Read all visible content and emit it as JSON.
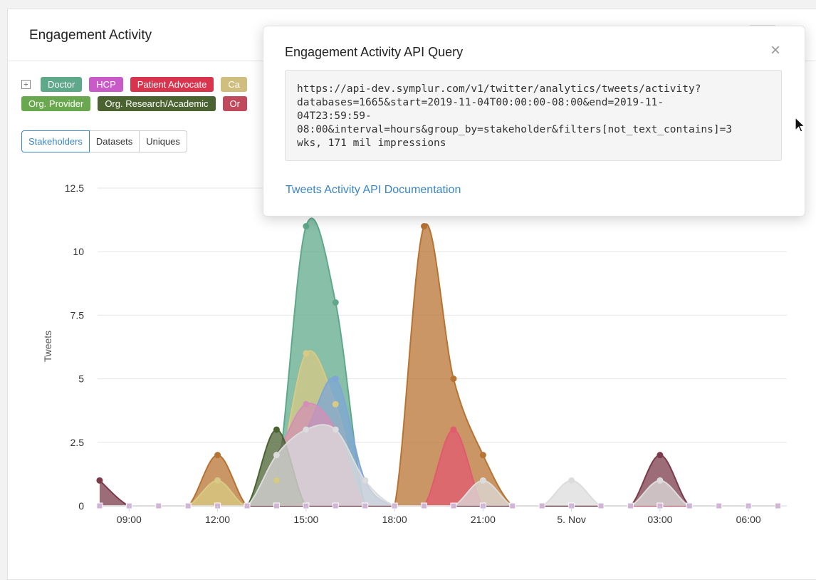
{
  "card": {
    "title": "Engagement Activity"
  },
  "legend": {
    "expand_label": "+",
    "row1": [
      {
        "label": "Doctor",
        "color": "#5fa98b"
      },
      {
        "label": "HCP",
        "color": "#c85bc7"
      },
      {
        "label": "Patient Advocate",
        "color": "#d8344d"
      },
      {
        "label": "Ca",
        "color": "#cfbe7d"
      }
    ],
    "row2": [
      {
        "label": "Org. Provider",
        "color": "#6aa84f"
      },
      {
        "label": "Org. Research/Academic",
        "color": "#4a6331"
      },
      {
        "label": "Or",
        "color": "#c0495c"
      }
    ]
  },
  "tabs": [
    {
      "label": "Stakeholders",
      "active": true
    },
    {
      "label": "Datasets",
      "active": false
    },
    {
      "label": "Uniques",
      "active": false
    }
  ],
  "popover": {
    "title": "Engagement Activity API Query",
    "close": "×",
    "query": "https://api-dev.symplur.com/v1/twitter/analytics/tweets/activity?\ndatabases=1665&start=2019-11-04T00:00:00-08:00&end=2019-11-\n04T23:59:59-\n08:00&interval=hours&group_by=stakeholder&filters[not_text_contains]=3\nwks, 171 mil impressions",
    "doc_link": "Tweets Activity API Documentation"
  },
  "chart_data": {
    "type": "area",
    "ylabel": "Tweets",
    "ylim": [
      0,
      12.5
    ],
    "yticks": [
      "0",
      "2.5",
      "5",
      "7.5",
      "10",
      "12.5"
    ],
    "x_hours": [
      8,
      9,
      10,
      11,
      12,
      13,
      14,
      15,
      16,
      17,
      18,
      19,
      20,
      21,
      22,
      23,
      24,
      25,
      26,
      27,
      28,
      29,
      30,
      31
    ],
    "xticks": [
      {
        "h": 9,
        "label": "09:00"
      },
      {
        "h": 12,
        "label": "12:00"
      },
      {
        "h": 15,
        "label": "15:00"
      },
      {
        "h": 18,
        "label": "18:00"
      },
      {
        "h": 21,
        "label": "21:00"
      },
      {
        "h": 24,
        "label": "5. Nov"
      },
      {
        "h": 27,
        "label": "03:00"
      },
      {
        "h": 30,
        "label": "06:00"
      }
    ],
    "series": [
      {
        "color": "#b87333",
        "values": [
          0,
          0,
          0,
          0,
          2,
          0,
          0,
          0,
          0,
          0,
          0,
          11,
          5,
          2,
          0,
          0,
          0,
          0,
          0,
          0,
          0,
          0,
          0,
          0
        ]
      },
      {
        "color": "#5fa98b",
        "values": [
          0,
          0,
          0,
          0,
          0,
          0,
          1,
          11,
          8,
          0,
          0,
          0,
          0,
          0,
          0,
          0,
          0,
          0,
          0,
          0,
          0,
          0,
          0,
          0
        ]
      },
      {
        "color": "#d8ca84",
        "values": [
          0,
          0,
          0,
          0,
          1,
          0,
          1,
          6,
          4,
          0,
          0,
          0,
          0,
          0,
          0,
          0,
          0,
          0,
          0,
          0,
          0,
          0,
          0,
          0
        ]
      },
      {
        "color": "#7fa6d6",
        "values": [
          0,
          0,
          0,
          0,
          0,
          0,
          2,
          3,
          5,
          1,
          0,
          0,
          0,
          0,
          0,
          0,
          0,
          0,
          0,
          0,
          0,
          0,
          0,
          0
        ]
      },
      {
        "color": "#d48fb6",
        "values": [
          0,
          0,
          0,
          0,
          0,
          0,
          2,
          4,
          3,
          0,
          0,
          0,
          0,
          0,
          0,
          0,
          0,
          0,
          0,
          0,
          0,
          0,
          0,
          0
        ]
      },
      {
        "color": "#4a6331",
        "values": [
          0,
          0,
          0,
          0,
          0,
          0,
          3,
          0,
          0,
          0,
          0,
          0,
          0,
          0,
          0,
          0,
          0,
          0,
          0,
          0,
          0,
          0,
          0,
          0
        ]
      },
      {
        "color": "#e05a70",
        "values": [
          0,
          0,
          0,
          0,
          0,
          0,
          0,
          0,
          0,
          0,
          0,
          0,
          3,
          0,
          0,
          0,
          0,
          0,
          0,
          0,
          0,
          0,
          0,
          0
        ]
      },
      {
        "color": "#7b3b4b",
        "values": [
          1,
          0,
          0,
          0,
          0,
          0,
          0,
          0,
          0,
          0,
          0,
          0,
          0,
          0,
          0,
          0,
          0,
          0,
          0,
          2,
          0,
          0,
          0,
          0
        ]
      },
      {
        "color": "#dcdcdc",
        "values": [
          0,
          0,
          0,
          0,
          0,
          0,
          2,
          3,
          3,
          1,
          0,
          0,
          0,
          1,
          0,
          0,
          1,
          0,
          0,
          1,
          0,
          0,
          0,
          0
        ]
      }
    ]
  }
}
